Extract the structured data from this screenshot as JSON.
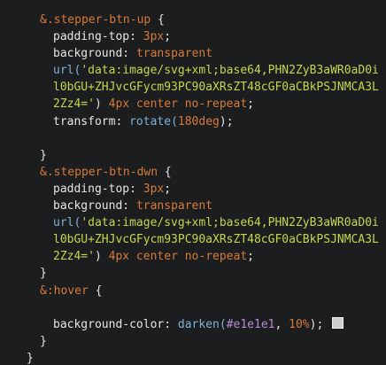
{
  "theme": {
    "background": "#1c1d1f",
    "default_text": "#e6e6e6",
    "selector": "#d77a3a",
    "string": "#c5d64e",
    "function": "#7fb3d5",
    "number": "#b78bd6"
  },
  "code_lines": [
    {
      "indent": 1,
      "tokens": [
        {
          "text": "&.stepper-btn-up",
          "type": "selector"
        },
        {
          "text": " {",
          "type": "punct"
        }
      ]
    },
    {
      "indent": 2,
      "tokens": [
        {
          "text": "padding-top",
          "type": "property"
        },
        {
          "text": ": ",
          "type": "punct"
        },
        {
          "text": "3px",
          "type": "selector"
        },
        {
          "text": ";",
          "type": "punct"
        }
      ]
    },
    {
      "indent": 2,
      "tokens": [
        {
          "text": "background",
          "type": "property"
        },
        {
          "text": ": ",
          "type": "punct"
        },
        {
          "text": "transparent",
          "type": "selector"
        }
      ]
    },
    {
      "indent": 2,
      "tokens": [
        {
          "text": "url(",
          "type": "function"
        },
        {
          "text": "'data:image/svg+xml;base64,PHN2ZyB3aWR0aD0i",
          "type": "string"
        }
      ]
    },
    {
      "indent": 2,
      "tokens": [
        {
          "text": "l0bGU+ZHJvcGFycm93PC90aXRsZT48cGF0aCBkPSJNMCA3L",
          "type": "string"
        }
      ]
    },
    {
      "indent": 2,
      "tokens": [
        {
          "text": "2Zz4='",
          "type": "string"
        },
        {
          "text": ") ",
          "type": "punct"
        },
        {
          "text": "4px center no-repeat",
          "type": "selector"
        },
        {
          "text": ";",
          "type": "punct"
        }
      ]
    },
    {
      "indent": 2,
      "tokens": [
        {
          "text": "transform",
          "type": "property"
        },
        {
          "text": ": ",
          "type": "punct"
        },
        {
          "text": "rotate(",
          "type": "function"
        },
        {
          "text": "180deg",
          "type": "selector"
        },
        {
          "text": ");",
          "type": "punct"
        }
      ]
    },
    {
      "indent": 2,
      "tokens": []
    },
    {
      "indent": 1,
      "tokens": [
        {
          "text": "}",
          "type": "punct"
        }
      ]
    },
    {
      "indent": 1,
      "tokens": [
        {
          "text": "&.stepper-btn-dwn",
          "type": "selector"
        },
        {
          "text": " {",
          "type": "punct"
        }
      ]
    },
    {
      "indent": 2,
      "tokens": [
        {
          "text": "padding-top",
          "type": "property"
        },
        {
          "text": ": ",
          "type": "punct"
        },
        {
          "text": "3px",
          "type": "selector"
        },
        {
          "text": ";",
          "type": "punct"
        }
      ]
    },
    {
      "indent": 2,
      "tokens": [
        {
          "text": "background",
          "type": "property"
        },
        {
          "text": ": ",
          "type": "punct"
        },
        {
          "text": "transparent",
          "type": "selector"
        }
      ]
    },
    {
      "indent": 2,
      "tokens": [
        {
          "text": "url(",
          "type": "function"
        },
        {
          "text": "'data:image/svg+xml;base64,PHN2ZyB3aWR0aD0i",
          "type": "string"
        }
      ]
    },
    {
      "indent": 2,
      "tokens": [
        {
          "text": "l0bGU+ZHJvcGFycm93PC90aXRsZT48cGF0aCBkPSJNMCA3L",
          "type": "string"
        }
      ]
    },
    {
      "indent": 2,
      "tokens": [
        {
          "text": "2Zz4='",
          "type": "string"
        },
        {
          "text": ") ",
          "type": "punct"
        },
        {
          "text": "4px center no-repeat",
          "type": "selector"
        },
        {
          "text": ";",
          "type": "punct"
        }
      ]
    },
    {
      "indent": 1,
      "tokens": [
        {
          "text": "}",
          "type": "punct"
        }
      ]
    },
    {
      "indent": 1,
      "tokens": [
        {
          "text": "&:hover",
          "type": "selector"
        },
        {
          "text": " {",
          "type": "punct"
        }
      ]
    },
    {
      "indent": 2,
      "tokens": []
    },
    {
      "indent": 2,
      "tokens": [
        {
          "text": "background-color",
          "type": "property"
        },
        {
          "text": ": ",
          "type": "punct"
        },
        {
          "text": "darken(",
          "type": "function"
        },
        {
          "text": "#e1e1e1",
          "type": "number"
        },
        {
          "text": ", ",
          "type": "punct"
        },
        {
          "text": "10%",
          "type": "selector"
        },
        {
          "text": ");",
          "type": "punct"
        }
      ],
      "swatch": "#cfcfcf"
    },
    {
      "indent": 1,
      "tokens": [
        {
          "text": "}",
          "type": "punct"
        }
      ]
    },
    {
      "indent": 0,
      "tokens": [
        {
          "text": "}",
          "type": "punct"
        }
      ]
    }
  ]
}
